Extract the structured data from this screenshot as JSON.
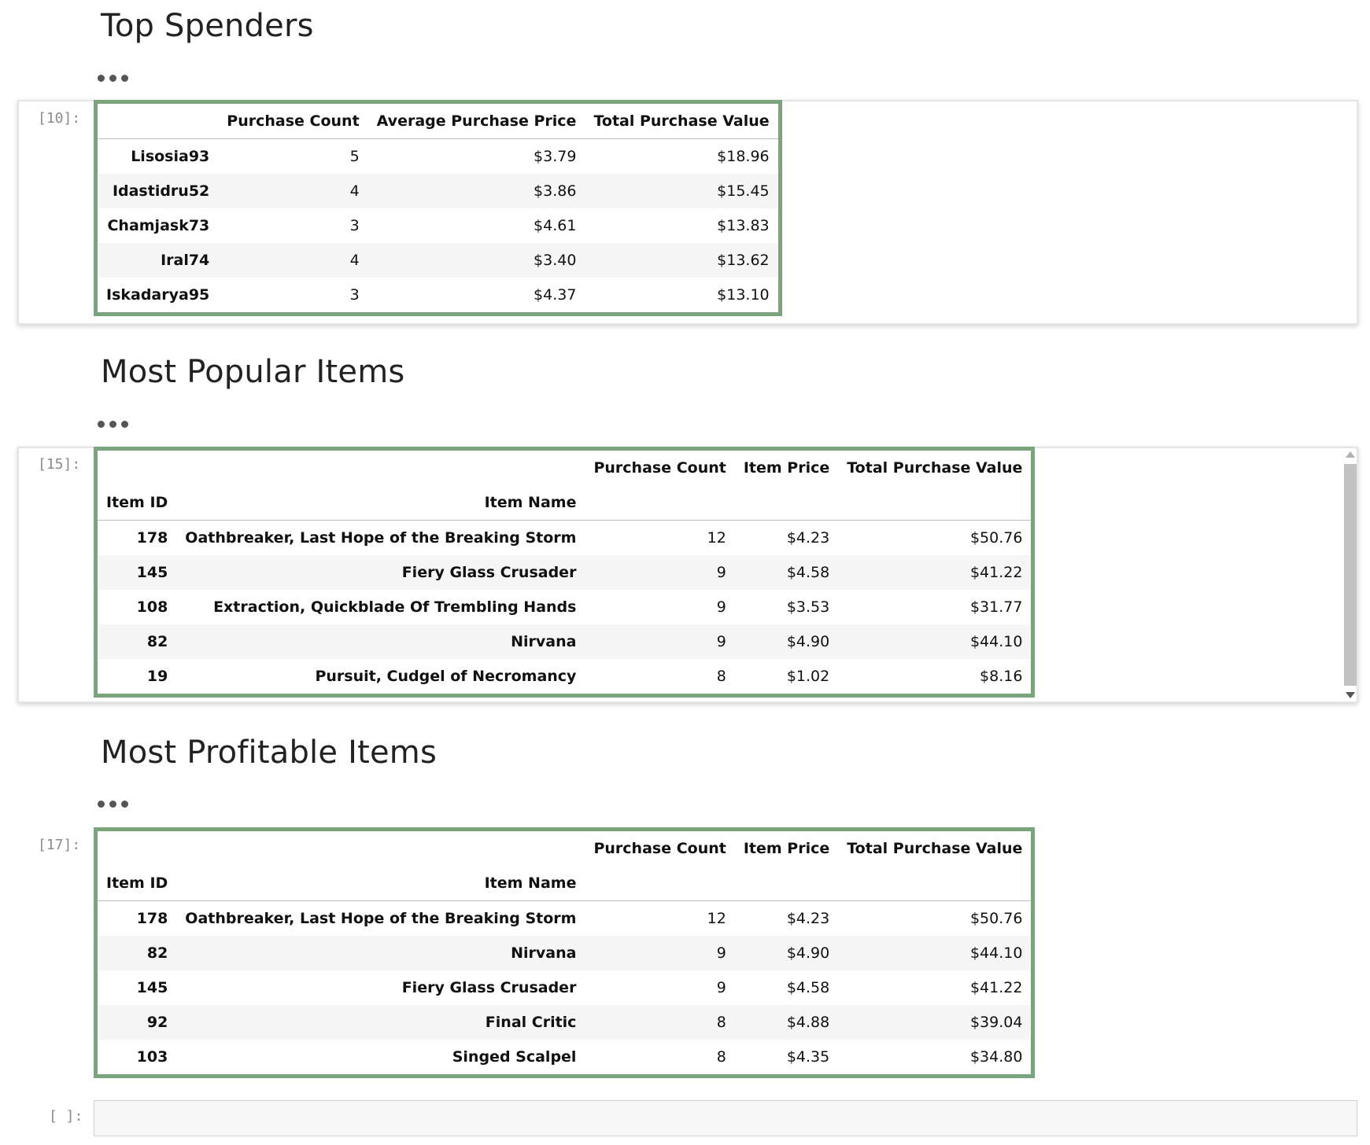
{
  "cells": {
    "top_spenders": {
      "heading": "Top Spenders",
      "prompt": "[10]:",
      "columns": [
        "",
        "Purchase Count",
        "Average Purchase Price",
        "Total Purchase Value"
      ],
      "rows": [
        {
          "name": "Lisosia93",
          "count": "5",
          "avg": "$3.79",
          "total": "$18.96"
        },
        {
          "name": "Idastidru52",
          "count": "4",
          "avg": "$3.86",
          "total": "$15.45"
        },
        {
          "name": "Chamjask73",
          "count": "3",
          "avg": "$4.61",
          "total": "$13.83"
        },
        {
          "name": "Iral74",
          "count": "4",
          "avg": "$3.40",
          "total": "$13.62"
        },
        {
          "name": "Iskadarya95",
          "count": "3",
          "avg": "$4.37",
          "total": "$13.10"
        }
      ]
    },
    "most_popular": {
      "heading": "Most Popular Items",
      "prompt": "[15]:",
      "columns": [
        "Purchase Count",
        "Item Price",
        "Total Purchase Value"
      ],
      "index_names": [
        "Item ID",
        "Item Name"
      ],
      "rows": [
        {
          "id": "178",
          "name": "Oathbreaker, Last Hope of the Breaking Storm",
          "count": "12",
          "price": "$4.23",
          "total": "$50.76"
        },
        {
          "id": "145",
          "name": "Fiery Glass Crusader",
          "count": "9",
          "price": "$4.58",
          "total": "$41.22"
        },
        {
          "id": "108",
          "name": "Extraction, Quickblade Of Trembling Hands",
          "count": "9",
          "price": "$3.53",
          "total": "$31.77"
        },
        {
          "id": "82",
          "name": "Nirvana",
          "count": "9",
          "price": "$4.90",
          "total": "$44.10"
        },
        {
          "id": "19",
          "name": "Pursuit, Cudgel of Necromancy",
          "count": "8",
          "price": "$1.02",
          "total": "$8.16"
        }
      ]
    },
    "most_profitable": {
      "heading": "Most Profitable Items",
      "prompt": "[17]:",
      "columns": [
        "Purchase Count",
        "Item Price",
        "Total Purchase Value"
      ],
      "index_names": [
        "Item ID",
        "Item Name"
      ],
      "rows": [
        {
          "id": "178",
          "name": "Oathbreaker, Last Hope of the Breaking Storm",
          "count": "12",
          "price": "$4.23",
          "total": "$50.76"
        },
        {
          "id": "82",
          "name": "Nirvana",
          "count": "9",
          "price": "$4.90",
          "total": "$44.10"
        },
        {
          "id": "145",
          "name": "Fiery Glass Crusader",
          "count": "9",
          "price": "$4.58",
          "total": "$41.22"
        },
        {
          "id": "92",
          "name": "Final Critic",
          "count": "8",
          "price": "$4.88",
          "total": "$39.04"
        },
        {
          "id": "103",
          "name": "Singed Scalpel",
          "count": "8",
          "price": "$4.35",
          "total": "$34.80"
        }
      ]
    },
    "empty_cell": {
      "prompt": "[ ]:"
    }
  },
  "colors": {
    "dataframe_border": "#7aa57c",
    "prompt_text": "#8a8a8a",
    "stripe": "#f5f5f5"
  },
  "icons": [
    "ellipsis-icon",
    "scroll-up-arrow-icon",
    "scroll-down-arrow-icon"
  ]
}
